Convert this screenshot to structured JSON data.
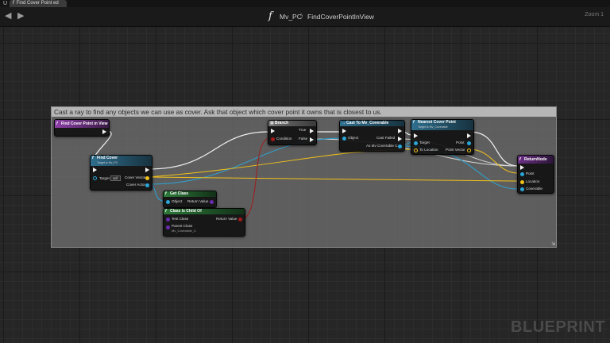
{
  "tab": {
    "label": "Find Cover Point ed"
  },
  "toolbar": {
    "back_icon": "arrow-left-icon",
    "forward_icon": "arrow-right-icon",
    "function_icon_glyph": "f",
    "breadcrumb": [
      "Mv_PC",
      "FindCoverPointInView"
    ],
    "breadcrumb_separator": "〉",
    "zoom_label": "Zoom 1"
  },
  "comment": {
    "text": "Cast a ray to find any objects we can use as cover. Ask that object which cover point it owns that is closest to us."
  },
  "nodes": {
    "entry": {
      "title": "Find Cover Point in View"
    },
    "find_cover": {
      "title": "Find Cover",
      "subtitle": "Target is Mv_PC",
      "target": "Target",
      "self": "self",
      "cover_vector": "Cover Vector",
      "cover_actor": "Cover Actor"
    },
    "get_class": {
      "title": "Get Class",
      "object": "Object",
      "return_value": "Return Value"
    },
    "class_is_child_of": {
      "title": "Class Is Child Of",
      "test_class": "Test Class",
      "parent_class": "Parent Class",
      "parent_value": "Mv_Coverable_C",
      "return_value": "Return Value"
    },
    "branch": {
      "title": "Branch",
      "condition": "Condition",
      "true": "True",
      "false": "False"
    },
    "cast": {
      "title": "Cast To Mv_Coverable",
      "object": "Object",
      "cast_failed": "Cast Failed",
      "as": "As Mv Coverable C"
    },
    "nearest": {
      "title": "Nearest Cover Point",
      "subtitle": "Target is Mv_Coverable",
      "target": "Target",
      "to_location": "To Location",
      "point": "Point",
      "point_vector": "Point Vector"
    },
    "return": {
      "title": "ReturnNode",
      "point": "Point",
      "location": "Location",
      "coverable": "Coverable"
    }
  },
  "watermark": "BLUEPRINT",
  "colors": {
    "exec_wire": "#f2f2f2",
    "object_pin": "#2aa6d9",
    "vector_pin": "#f2c21a",
    "class_pin": "#6a2bb0",
    "bool_pin": "#a31b1b",
    "event_header": "#8c3fa6",
    "function_header": "#2f6f8e"
  }
}
